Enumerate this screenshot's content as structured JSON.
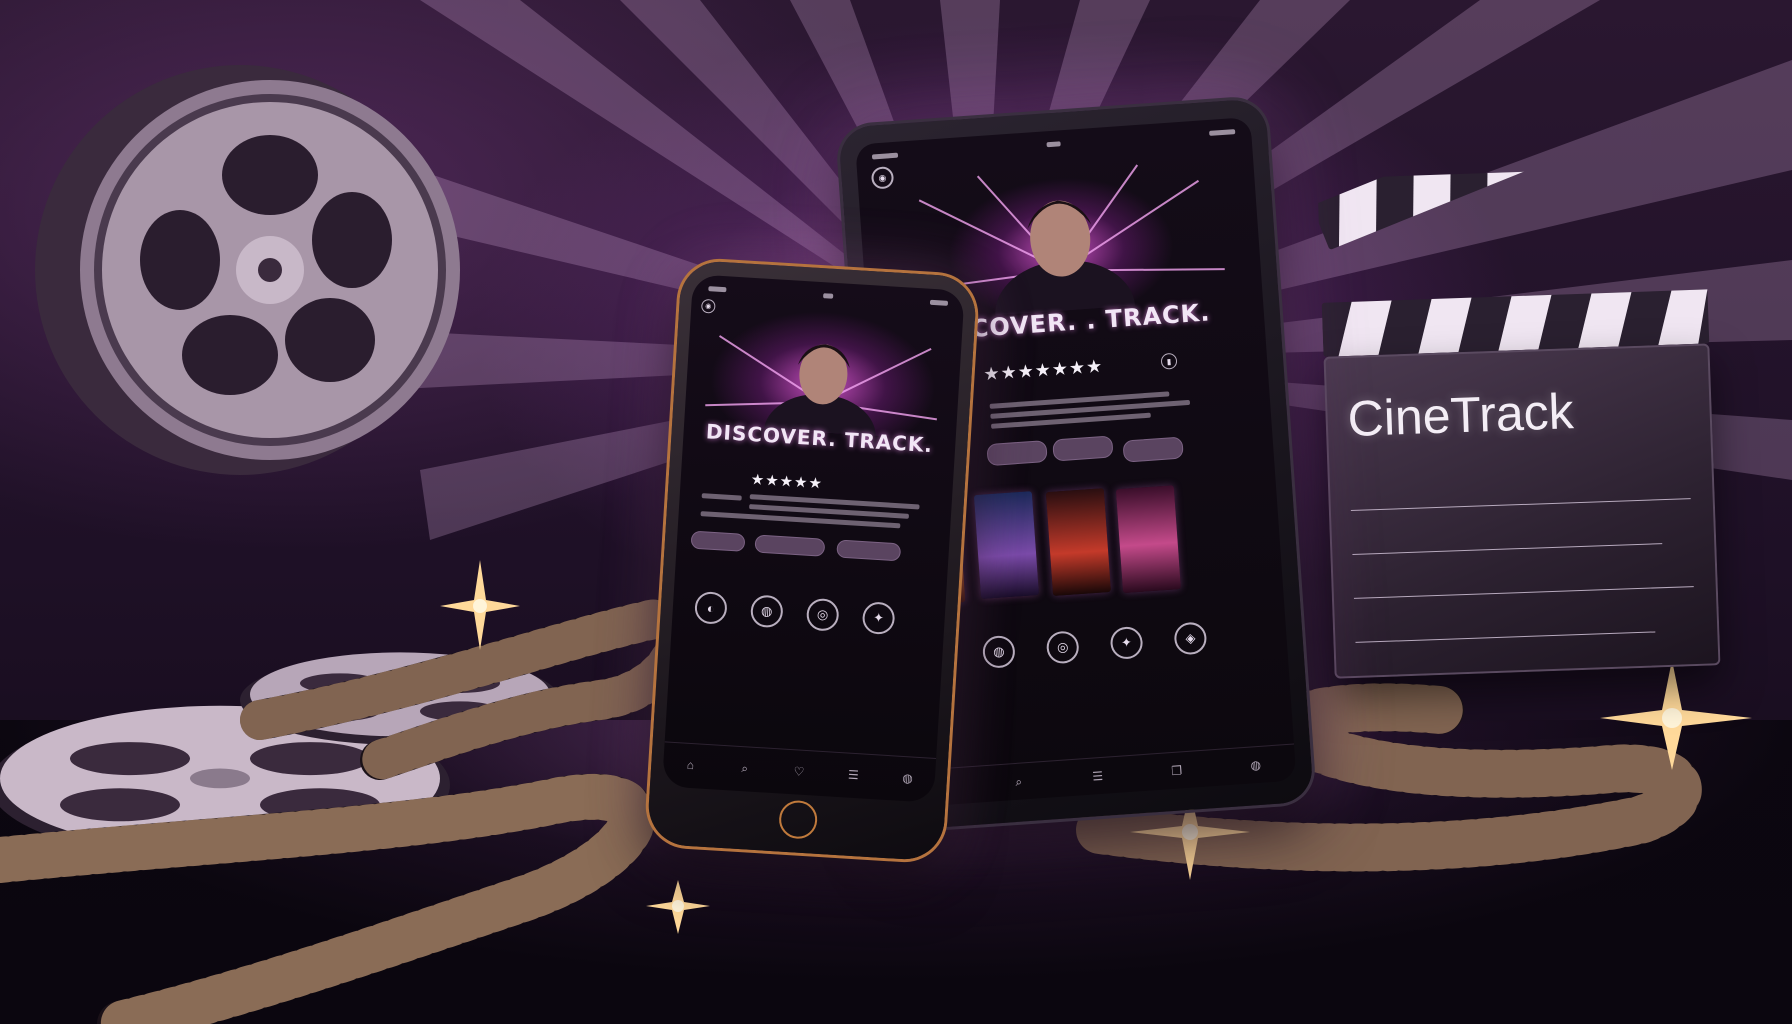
{
  "brand": {
    "name": "CineTrack"
  },
  "tablet": {
    "headline": "DISCOVER. . TRACK.",
    "rating": "★★★★★★★",
    "buttons": [
      "",
      "",
      ""
    ],
    "section_label": "",
    "categories": [
      "",
      "",
      "",
      "",
      ""
    ]
  },
  "phone": {
    "headline": "DISCOVER. TRACK.",
    "rating": "★★★★★",
    "buttons": [
      "",
      "",
      ""
    ],
    "section_label": "",
    "categories": [
      "",
      "",
      "",
      ""
    ],
    "nav": [
      "",
      "",
      "",
      "",
      ""
    ]
  },
  "colors": {
    "accent": "#d96ad8",
    "glow": "#f5b46a",
    "background": "#1e1026"
  }
}
